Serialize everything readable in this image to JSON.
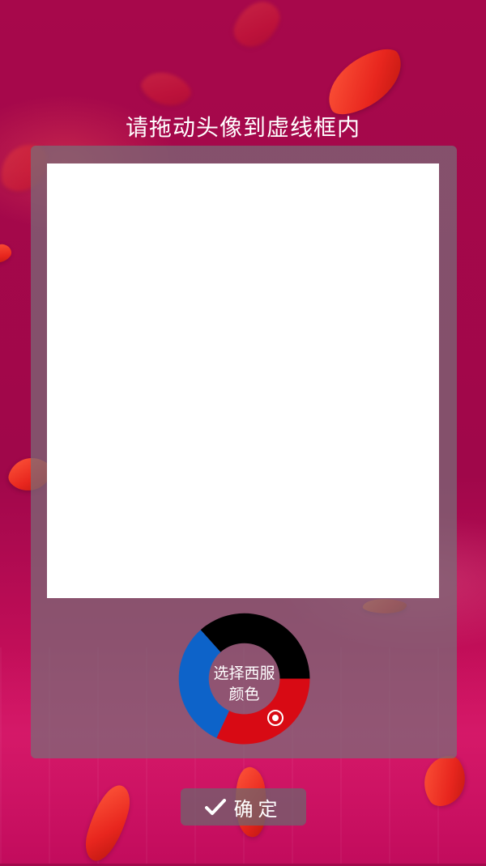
{
  "header": {
    "instruction": "请拖动头像到虚线框内"
  },
  "color_wheel": {
    "label_line1": "选择西服",
    "label_line2": "颜色",
    "options": [
      {
        "name": "black",
        "color": "#000000"
      },
      {
        "name": "red",
        "color": "#d80a14"
      },
      {
        "name": "blue",
        "color": "#0d63c9"
      }
    ],
    "selected": "red"
  },
  "footer": {
    "confirm_label": "确定",
    "confirm_icon": "check-icon"
  },
  "theme": {
    "background": "#a3094c",
    "photo_area": "#ffffff"
  }
}
